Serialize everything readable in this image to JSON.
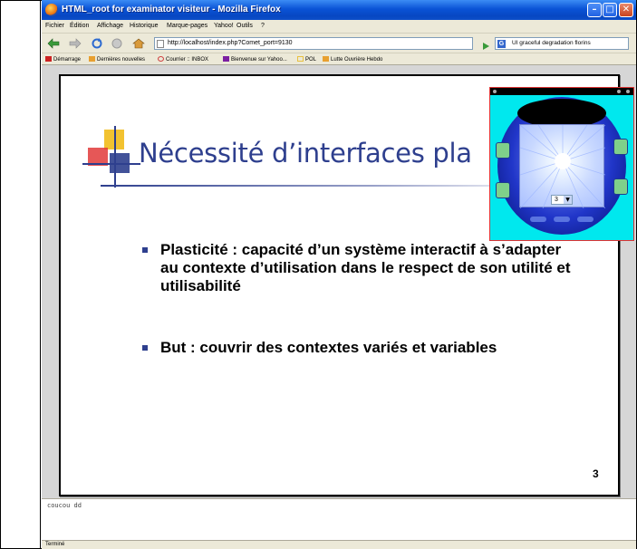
{
  "window": {
    "title": "HTML_root for examinator visiteur - Mozilla Firefox",
    "controls": {
      "minimize": "–",
      "maximize": "□",
      "close": "✕"
    }
  },
  "menubar": {
    "items": [
      "Fichier",
      "Édition",
      "Affichage",
      "Historique",
      "Marque-pages",
      "Yahoo!",
      "Outils",
      "?"
    ]
  },
  "navbar": {
    "url": "http://localhost/index.php?Comet_port=9130",
    "search_text": "UI graceful degradation florins"
  },
  "bookmarks": {
    "items": [
      {
        "label": "Démarrage",
        "color": "#cc2222"
      },
      {
        "label": "Dernières nouvelles",
        "color": "#e8a030"
      },
      {
        "label": "Courrier :: INBOX",
        "color": "#d04040"
      },
      {
        "label": "Bienvenue sur Yahoo...",
        "color": "#7b1fa2"
      },
      {
        "label": "POL",
        "color": "#e8c040"
      },
      {
        "label": "Lutte Ouvrière Hebdo",
        "color": "#e8a030"
      }
    ]
  },
  "slide": {
    "title": "Nécessité d’interfaces pla",
    "bullets": [
      "Plasticité : capacité d’un système interactif à s’adapter au contexte d’utilisation dans le respect de son utilité et utilisabilité",
      "But : couvrir des contextes variés et variables"
    ],
    "number": "3",
    "accent_color": "#2e3f8e"
  },
  "widget": {
    "stepper_value": "3"
  },
  "console": {
    "text": "coucou dd"
  },
  "statusbar": {
    "text": "Terminé"
  }
}
